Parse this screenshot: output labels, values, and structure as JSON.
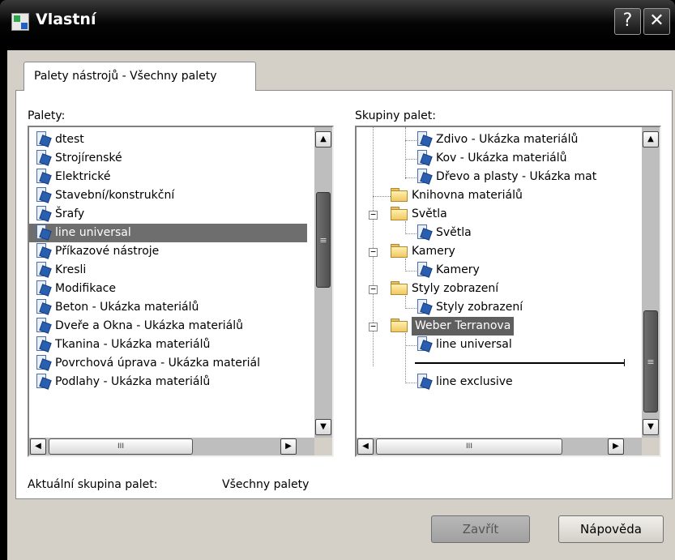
{
  "window": {
    "title": "Vlastní",
    "help_glyph": "?",
    "close_glyph": "✕"
  },
  "tab": {
    "label": "Palety nástrojů - Všechny palety"
  },
  "palettes": {
    "label": "Palety:",
    "items": [
      "dtest",
      "Strojírenské",
      "Elektrické",
      "Stavební/konstrukční",
      "Šrafy",
      "line universal",
      "Příkazové nástroje",
      "Kresli",
      "Modifikace",
      "Beton - Ukázka materiálů",
      "Dveře a Okna - Ukázka materiálů",
      "Tkanina - Ukázka materiálů",
      "Povrchová úprava - Ukázka materiál",
      "Podlahy - Ukázka materiálů"
    ],
    "selected": "line universal"
  },
  "groups": {
    "label": "Skupiny palet:",
    "items": [
      "Zdivo - Ukázka materiálů",
      "Kov - Ukázka materiálů",
      "Dřevo a plasty - Ukázka mat",
      "Knihovna materiálů",
      "Světla",
      "Světla",
      "Kamery",
      "Kamery",
      "Styly zobrazení",
      "Styly zobrazení",
      "Weber Terranova",
      "line universal",
      "line exclusive"
    ],
    "selected": "Weber Terranova"
  },
  "scroll": {
    "up": "▲",
    "down": "▼",
    "left": "◀",
    "right": "▶",
    "grip_v": "≡",
    "grip_h": "III"
  },
  "current_group": {
    "label": "Aktuální skupina palet:",
    "value": "Všechny palety"
  },
  "buttons": {
    "close": "Zavřít",
    "help": "Nápověda"
  },
  "colors": {
    "titlebar": "#000000",
    "panel": "#d4d0c8",
    "selection": "#6e6e6e"
  }
}
